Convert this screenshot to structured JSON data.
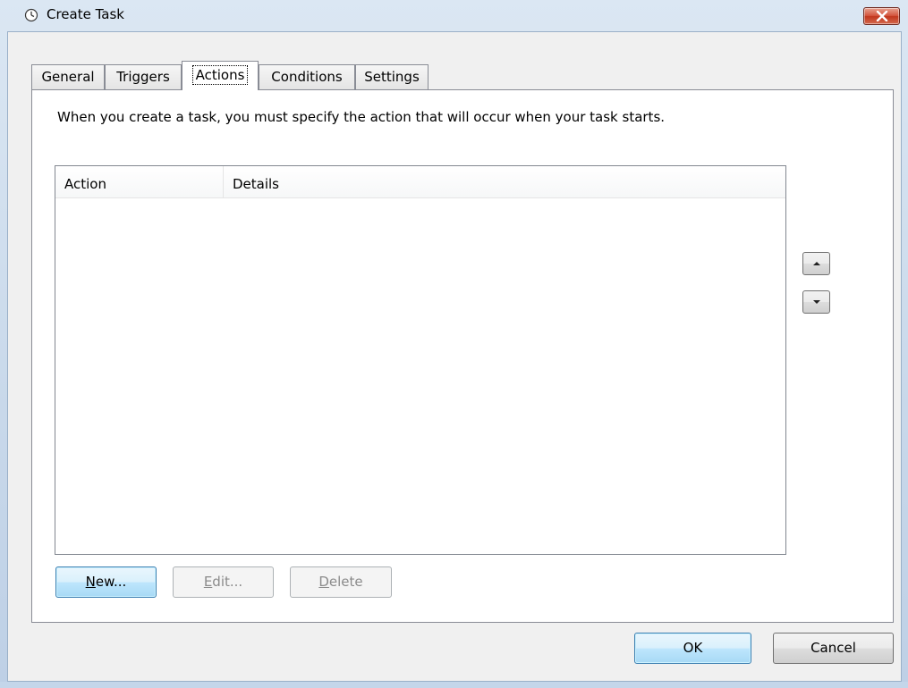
{
  "window": {
    "title": "Create Task",
    "title_icon": "clock-icon",
    "close_icon": "close-icon"
  },
  "tabs": [
    {
      "label": "General",
      "active": false
    },
    {
      "label": "Triggers",
      "active": false
    },
    {
      "label": "Actions",
      "active": true
    },
    {
      "label": "Conditions",
      "active": false
    },
    {
      "label": "Settings",
      "active": false
    }
  ],
  "actions_tab": {
    "description": "When you create a task, you must specify the action that will occur when your task starts.",
    "list": {
      "columns": [
        "Action",
        "Details"
      ],
      "rows": []
    },
    "move_up_icon": "triangle-up-icon",
    "move_down_icon": "triangle-down-icon",
    "buttons": {
      "new": {
        "label": "New...",
        "access_key": "N",
        "rest": "ew...",
        "enabled": true
      },
      "edit": {
        "label": "Edit...",
        "access_key": "E",
        "rest": "dit...",
        "enabled": false
      },
      "delete": {
        "label": "Delete",
        "access_key": "D",
        "rest": "elete",
        "enabled": false
      }
    }
  },
  "footer": {
    "ok": "OK",
    "cancel": "Cancel"
  },
  "colors": {
    "default_button_border": "#3c7fb1",
    "close_button": "#c1361d"
  }
}
